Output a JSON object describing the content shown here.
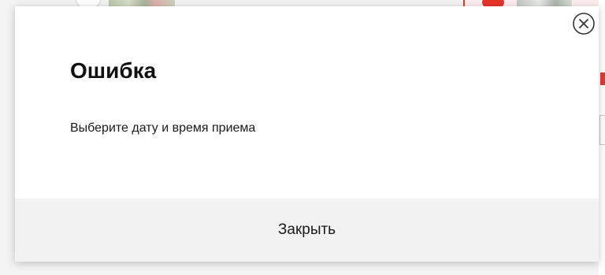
{
  "dialog": {
    "title": "Ошибка",
    "message": "Выберите дату и время приема",
    "close_button_label": "Закрыть"
  },
  "icons": {
    "close": "close-circle-icon"
  },
  "colors": {
    "accent_red": "#e23b2e",
    "footer_bg": "#f2f2f2",
    "title_text": "#111111"
  }
}
